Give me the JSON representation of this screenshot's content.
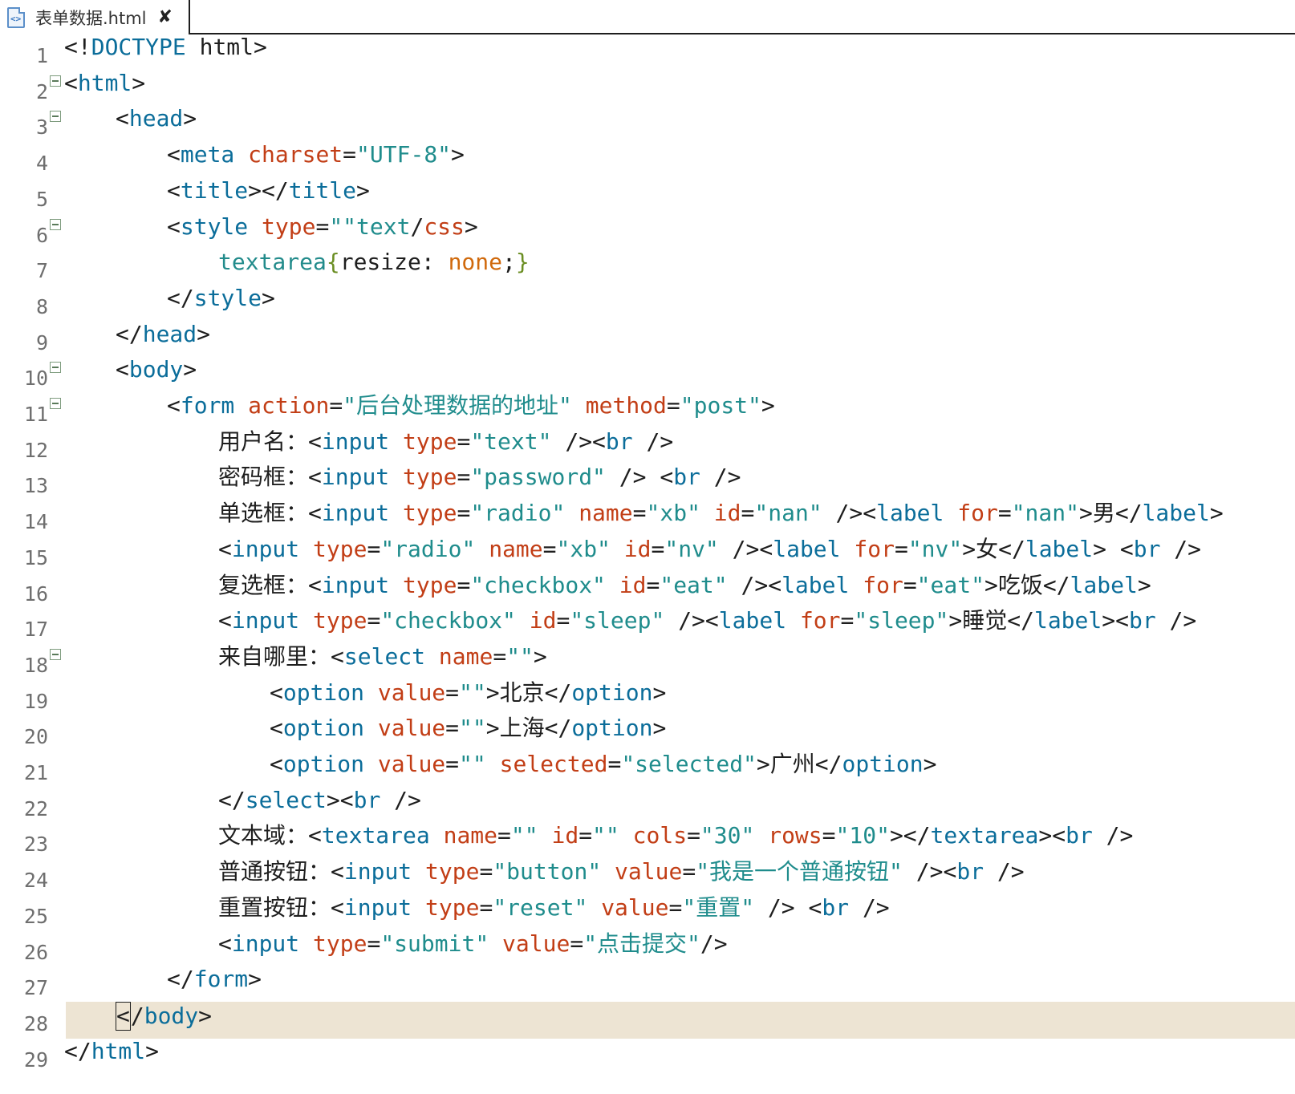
{
  "tab": {
    "file_name": "表单数据.html",
    "icon": "html-file-icon",
    "close_glyph": "✘"
  },
  "colors": {
    "tag": "#0b6d9a",
    "attribute": "#c23e16",
    "string": "#1f8c8c",
    "current_line": "#ede4d3",
    "line_number": "#6f6f6f"
  },
  "current_line": 28,
  "lines": [
    {
      "n": "1",
      "fold": false,
      "indent": 0,
      "tokens": [
        [
          "p",
          "<!"
        ],
        [
          "k",
          "DOCTYPE"
        ],
        [
          "p",
          " html>"
        ]
      ]
    },
    {
      "n": "2",
      "fold": true,
      "indent": 0,
      "tokens": [
        [
          "p",
          "<"
        ],
        [
          "k",
          "html"
        ],
        [
          "p",
          ">"
        ]
      ]
    },
    {
      "n": "3",
      "fold": true,
      "indent": 1,
      "tokens": [
        [
          "p",
          "<"
        ],
        [
          "k",
          "head"
        ],
        [
          "p",
          ">"
        ]
      ]
    },
    {
      "n": "4",
      "fold": false,
      "indent": 2,
      "tokens": [
        [
          "p",
          "<"
        ],
        [
          "k",
          "meta"
        ],
        [
          "p",
          " "
        ],
        [
          "a",
          "charset"
        ],
        [
          "p",
          "="
        ],
        [
          "s",
          "\"UTF-8\""
        ],
        [
          "p",
          ">"
        ]
      ]
    },
    {
      "n": "5",
      "fold": false,
      "indent": 2,
      "tokens": [
        [
          "p",
          "<"
        ],
        [
          "k",
          "title"
        ],
        [
          "p",
          "></"
        ],
        [
          "k",
          "title"
        ],
        [
          "p",
          ">"
        ]
      ]
    },
    {
      "n": "6",
      "fold": true,
      "indent": 2,
      "tokens": [
        [
          "p",
          "<"
        ],
        [
          "k",
          "style"
        ],
        [
          "p",
          " "
        ],
        [
          "a",
          "type"
        ],
        [
          "p",
          "="
        ],
        [
          "s",
          "\"\"text"
        ],
        [
          "p",
          "/"
        ],
        [
          "a",
          "css"
        ],
        [
          "p",
          ">"
        ]
      ]
    },
    {
      "n": "7",
      "fold": false,
      "indent": 3,
      "tokens": [
        [
          "c",
          "textarea"
        ],
        [
          "g",
          "{"
        ],
        [
          "p",
          "resize: "
        ],
        [
          "o",
          "none"
        ],
        [
          "p",
          ";"
        ],
        [
          "g",
          "}"
        ]
      ]
    },
    {
      "n": "8",
      "fold": false,
      "indent": 2,
      "tokens": [
        [
          "p",
          "</"
        ],
        [
          "k",
          "style"
        ],
        [
          "p",
          ">"
        ]
      ]
    },
    {
      "n": "9",
      "fold": false,
      "indent": 1,
      "tokens": [
        [
          "p",
          "</"
        ],
        [
          "k",
          "head"
        ],
        [
          "p",
          ">"
        ]
      ]
    },
    {
      "n": "10",
      "fold": true,
      "indent": 1,
      "tokens": [
        [
          "p",
          "<"
        ],
        [
          "k",
          "body"
        ],
        [
          "p",
          ">"
        ]
      ]
    },
    {
      "n": "11",
      "fold": true,
      "indent": 2,
      "tokens": [
        [
          "p",
          "<"
        ],
        [
          "k",
          "form"
        ],
        [
          "p",
          " "
        ],
        [
          "a",
          "action"
        ],
        [
          "p",
          "="
        ],
        [
          "s",
          "\"后台处理数据的地址\""
        ],
        [
          "p",
          " "
        ],
        [
          "a",
          "method"
        ],
        [
          "p",
          "="
        ],
        [
          "s",
          "\"post\""
        ],
        [
          "p",
          ">"
        ]
      ]
    },
    {
      "n": "12",
      "fold": false,
      "indent": 3,
      "tokens": [
        [
          "t",
          "用户名："
        ],
        [
          "p",
          "<"
        ],
        [
          "k",
          "input"
        ],
        [
          "p",
          " "
        ],
        [
          "a",
          "type"
        ],
        [
          "p",
          "="
        ],
        [
          "s",
          "\"text\""
        ],
        [
          "p",
          " /><"
        ],
        [
          "k",
          "br"
        ],
        [
          "p",
          " />"
        ]
      ]
    },
    {
      "n": "13",
      "fold": false,
      "indent": 3,
      "tokens": [
        [
          "t",
          "密码框："
        ],
        [
          "p",
          "<"
        ],
        [
          "k",
          "input"
        ],
        [
          "p",
          " "
        ],
        [
          "a",
          "type"
        ],
        [
          "p",
          "="
        ],
        [
          "s",
          "\"password\""
        ],
        [
          "p",
          " /> <"
        ],
        [
          "k",
          "br"
        ],
        [
          "p",
          " />"
        ]
      ]
    },
    {
      "n": "14",
      "fold": false,
      "indent": 3,
      "tokens": [
        [
          "t",
          "单选框："
        ],
        [
          "p",
          "<"
        ],
        [
          "k",
          "input"
        ],
        [
          "p",
          " "
        ],
        [
          "a",
          "type"
        ],
        [
          "p",
          "="
        ],
        [
          "s",
          "\"radio\""
        ],
        [
          "p",
          " "
        ],
        [
          "a",
          "name"
        ],
        [
          "p",
          "="
        ],
        [
          "s",
          "\"xb\""
        ],
        [
          "p",
          " "
        ],
        [
          "a",
          "id"
        ],
        [
          "p",
          "="
        ],
        [
          "s",
          "\"nan\""
        ],
        [
          "p",
          " /><"
        ],
        [
          "k",
          "label"
        ],
        [
          "p",
          " "
        ],
        [
          "a",
          "for"
        ],
        [
          "p",
          "="
        ],
        [
          "s",
          "\"nan\""
        ],
        [
          "p",
          ">男</"
        ],
        [
          "k",
          "label"
        ],
        [
          "p",
          ">"
        ]
      ]
    },
    {
      "n": "15",
      "fold": false,
      "indent": 3,
      "tokens": [
        [
          "p",
          "<"
        ],
        [
          "k",
          "input"
        ],
        [
          "p",
          " "
        ],
        [
          "a",
          "type"
        ],
        [
          "p",
          "="
        ],
        [
          "s",
          "\"radio\""
        ],
        [
          "p",
          " "
        ],
        [
          "a",
          "name"
        ],
        [
          "p",
          "="
        ],
        [
          "s",
          "\"xb\""
        ],
        [
          "p",
          " "
        ],
        [
          "a",
          "id"
        ],
        [
          "p",
          "="
        ],
        [
          "s",
          "\"nv\""
        ],
        [
          "p",
          " /><"
        ],
        [
          "k",
          "label"
        ],
        [
          "p",
          " "
        ],
        [
          "a",
          "for"
        ],
        [
          "p",
          "="
        ],
        [
          "s",
          "\"nv\""
        ],
        [
          "p",
          ">女</"
        ],
        [
          "k",
          "label"
        ],
        [
          "p",
          "> <"
        ],
        [
          "k",
          "br"
        ],
        [
          "p",
          " />"
        ]
      ]
    },
    {
      "n": "16",
      "fold": false,
      "indent": 3,
      "tokens": [
        [
          "t",
          "复选框："
        ],
        [
          "p",
          "<"
        ],
        [
          "k",
          "input"
        ],
        [
          "p",
          " "
        ],
        [
          "a",
          "type"
        ],
        [
          "p",
          "="
        ],
        [
          "s",
          "\"checkbox\""
        ],
        [
          "p",
          " "
        ],
        [
          "a",
          "id"
        ],
        [
          "p",
          "="
        ],
        [
          "s",
          "\"eat\""
        ],
        [
          "p",
          " /><"
        ],
        [
          "k",
          "label"
        ],
        [
          "p",
          " "
        ],
        [
          "a",
          "for"
        ],
        [
          "p",
          "="
        ],
        [
          "s",
          "\"eat\""
        ],
        [
          "p",
          ">吃饭</"
        ],
        [
          "k",
          "label"
        ],
        [
          "p",
          ">"
        ]
      ]
    },
    {
      "n": "17",
      "fold": false,
      "indent": 3,
      "tokens": [
        [
          "p",
          "<"
        ],
        [
          "k",
          "input"
        ],
        [
          "p",
          " "
        ],
        [
          "a",
          "type"
        ],
        [
          "p",
          "="
        ],
        [
          "s",
          "\"checkbox\""
        ],
        [
          "p",
          " "
        ],
        [
          "a",
          "id"
        ],
        [
          "p",
          "="
        ],
        [
          "s",
          "\"sleep\""
        ],
        [
          "p",
          " /><"
        ],
        [
          "k",
          "label"
        ],
        [
          "p",
          " "
        ],
        [
          "a",
          "for"
        ],
        [
          "p",
          "="
        ],
        [
          "s",
          "\"sleep\""
        ],
        [
          "p",
          ">睡觉</"
        ],
        [
          "k",
          "label"
        ],
        [
          "p",
          "><"
        ],
        [
          "k",
          "br"
        ],
        [
          "p",
          " />"
        ]
      ]
    },
    {
      "n": "18",
      "fold": true,
      "indent": 3,
      "tokens": [
        [
          "t",
          "来自哪里："
        ],
        [
          "p",
          "<"
        ],
        [
          "k",
          "select"
        ],
        [
          "p",
          " "
        ],
        [
          "a",
          "name"
        ],
        [
          "p",
          "="
        ],
        [
          "s",
          "\"\""
        ],
        [
          "p",
          ">"
        ]
      ]
    },
    {
      "n": "19",
      "fold": false,
      "indent": 4,
      "tokens": [
        [
          "p",
          "<"
        ],
        [
          "k",
          "option"
        ],
        [
          "p",
          " "
        ],
        [
          "a",
          "value"
        ],
        [
          "p",
          "="
        ],
        [
          "s",
          "\"\""
        ],
        [
          "p",
          ">北京</"
        ],
        [
          "k",
          "option"
        ],
        [
          "p",
          ">"
        ]
      ]
    },
    {
      "n": "20",
      "fold": false,
      "indent": 4,
      "tokens": [
        [
          "p",
          "<"
        ],
        [
          "k",
          "option"
        ],
        [
          "p",
          " "
        ],
        [
          "a",
          "value"
        ],
        [
          "p",
          "="
        ],
        [
          "s",
          "\"\""
        ],
        [
          "p",
          ">上海</"
        ],
        [
          "k",
          "option"
        ],
        [
          "p",
          ">"
        ]
      ]
    },
    {
      "n": "21",
      "fold": false,
      "indent": 4,
      "tokens": [
        [
          "p",
          "<"
        ],
        [
          "k",
          "option"
        ],
        [
          "p",
          " "
        ],
        [
          "a",
          "value"
        ],
        [
          "p",
          "="
        ],
        [
          "s",
          "\"\""
        ],
        [
          "p",
          " "
        ],
        [
          "a",
          "selected"
        ],
        [
          "p",
          "="
        ],
        [
          "s",
          "\"selected\""
        ],
        [
          "p",
          ">广州</"
        ],
        [
          "k",
          "option"
        ],
        [
          "p",
          ">"
        ]
      ]
    },
    {
      "n": "22",
      "fold": false,
      "indent": 3,
      "tokens": [
        [
          "p",
          "</"
        ],
        [
          "k",
          "select"
        ],
        [
          "p",
          "><"
        ],
        [
          "k",
          "br"
        ],
        [
          "p",
          " />"
        ]
      ]
    },
    {
      "n": "23",
      "fold": false,
      "indent": 3,
      "tokens": [
        [
          "t",
          "文本域："
        ],
        [
          "p",
          "<"
        ],
        [
          "k",
          "textarea"
        ],
        [
          "p",
          " "
        ],
        [
          "a",
          "name"
        ],
        [
          "p",
          "="
        ],
        [
          "s",
          "\"\""
        ],
        [
          "p",
          " "
        ],
        [
          "a",
          "id"
        ],
        [
          "p",
          "="
        ],
        [
          "s",
          "\"\""
        ],
        [
          "p",
          " "
        ],
        [
          "a",
          "cols"
        ],
        [
          "p",
          "="
        ],
        [
          "s",
          "\"30\""
        ],
        [
          "p",
          " "
        ],
        [
          "a",
          "rows"
        ],
        [
          "p",
          "="
        ],
        [
          "s",
          "\"10\""
        ],
        [
          "p",
          "></"
        ],
        [
          "k",
          "textarea"
        ],
        [
          "p",
          "><"
        ],
        [
          "k",
          "br"
        ],
        [
          "p",
          " />"
        ]
      ]
    },
    {
      "n": "24",
      "fold": false,
      "indent": 3,
      "tokens": [
        [
          "t",
          "普通按钮："
        ],
        [
          "p",
          "<"
        ],
        [
          "k",
          "input"
        ],
        [
          "p",
          " "
        ],
        [
          "a",
          "type"
        ],
        [
          "p",
          "="
        ],
        [
          "s",
          "\"button\""
        ],
        [
          "p",
          " "
        ],
        [
          "a",
          "value"
        ],
        [
          "p",
          "="
        ],
        [
          "s",
          "\"我是一个普通按钮\""
        ],
        [
          "p",
          " /><"
        ],
        [
          "k",
          "br"
        ],
        [
          "p",
          " />"
        ]
      ]
    },
    {
      "n": "25",
      "fold": false,
      "indent": 3,
      "tokens": [
        [
          "t",
          "重置按钮："
        ],
        [
          "p",
          "<"
        ],
        [
          "k",
          "input"
        ],
        [
          "p",
          " "
        ],
        [
          "a",
          "type"
        ],
        [
          "p",
          "="
        ],
        [
          "s",
          "\"reset\""
        ],
        [
          "p",
          " "
        ],
        [
          "a",
          "value"
        ],
        [
          "p",
          "="
        ],
        [
          "s",
          "\"重置\""
        ],
        [
          "p",
          " /> <"
        ],
        [
          "k",
          "br"
        ],
        [
          "p",
          " />"
        ]
      ]
    },
    {
      "n": "26",
      "fold": false,
      "indent": 3,
      "tokens": [
        [
          "p",
          "<"
        ],
        [
          "k",
          "input"
        ],
        [
          "p",
          " "
        ],
        [
          "a",
          "type"
        ],
        [
          "p",
          "="
        ],
        [
          "s",
          "\"submit\""
        ],
        [
          "p",
          " "
        ],
        [
          "a",
          "value"
        ],
        [
          "p",
          "="
        ],
        [
          "s",
          "\"点击提交\""
        ],
        [
          "p",
          "/>"
        ]
      ]
    },
    {
      "n": "27",
      "fold": false,
      "indent": 2,
      "tokens": [
        [
          "p",
          "</"
        ],
        [
          "k",
          "form"
        ],
        [
          "p",
          ">"
        ]
      ]
    },
    {
      "n": "28",
      "fold": false,
      "indent": 1,
      "tokens": [
        [
          "cursor",
          "<"
        ],
        [
          "p",
          "/"
        ],
        [
          "k",
          "body"
        ],
        [
          "p",
          ">"
        ]
      ]
    },
    {
      "n": "29",
      "fold": false,
      "indent": 0,
      "tokens": [
        [
          "p",
          "</"
        ],
        [
          "k",
          "html"
        ],
        [
          "p",
          ">"
        ]
      ]
    }
  ]
}
